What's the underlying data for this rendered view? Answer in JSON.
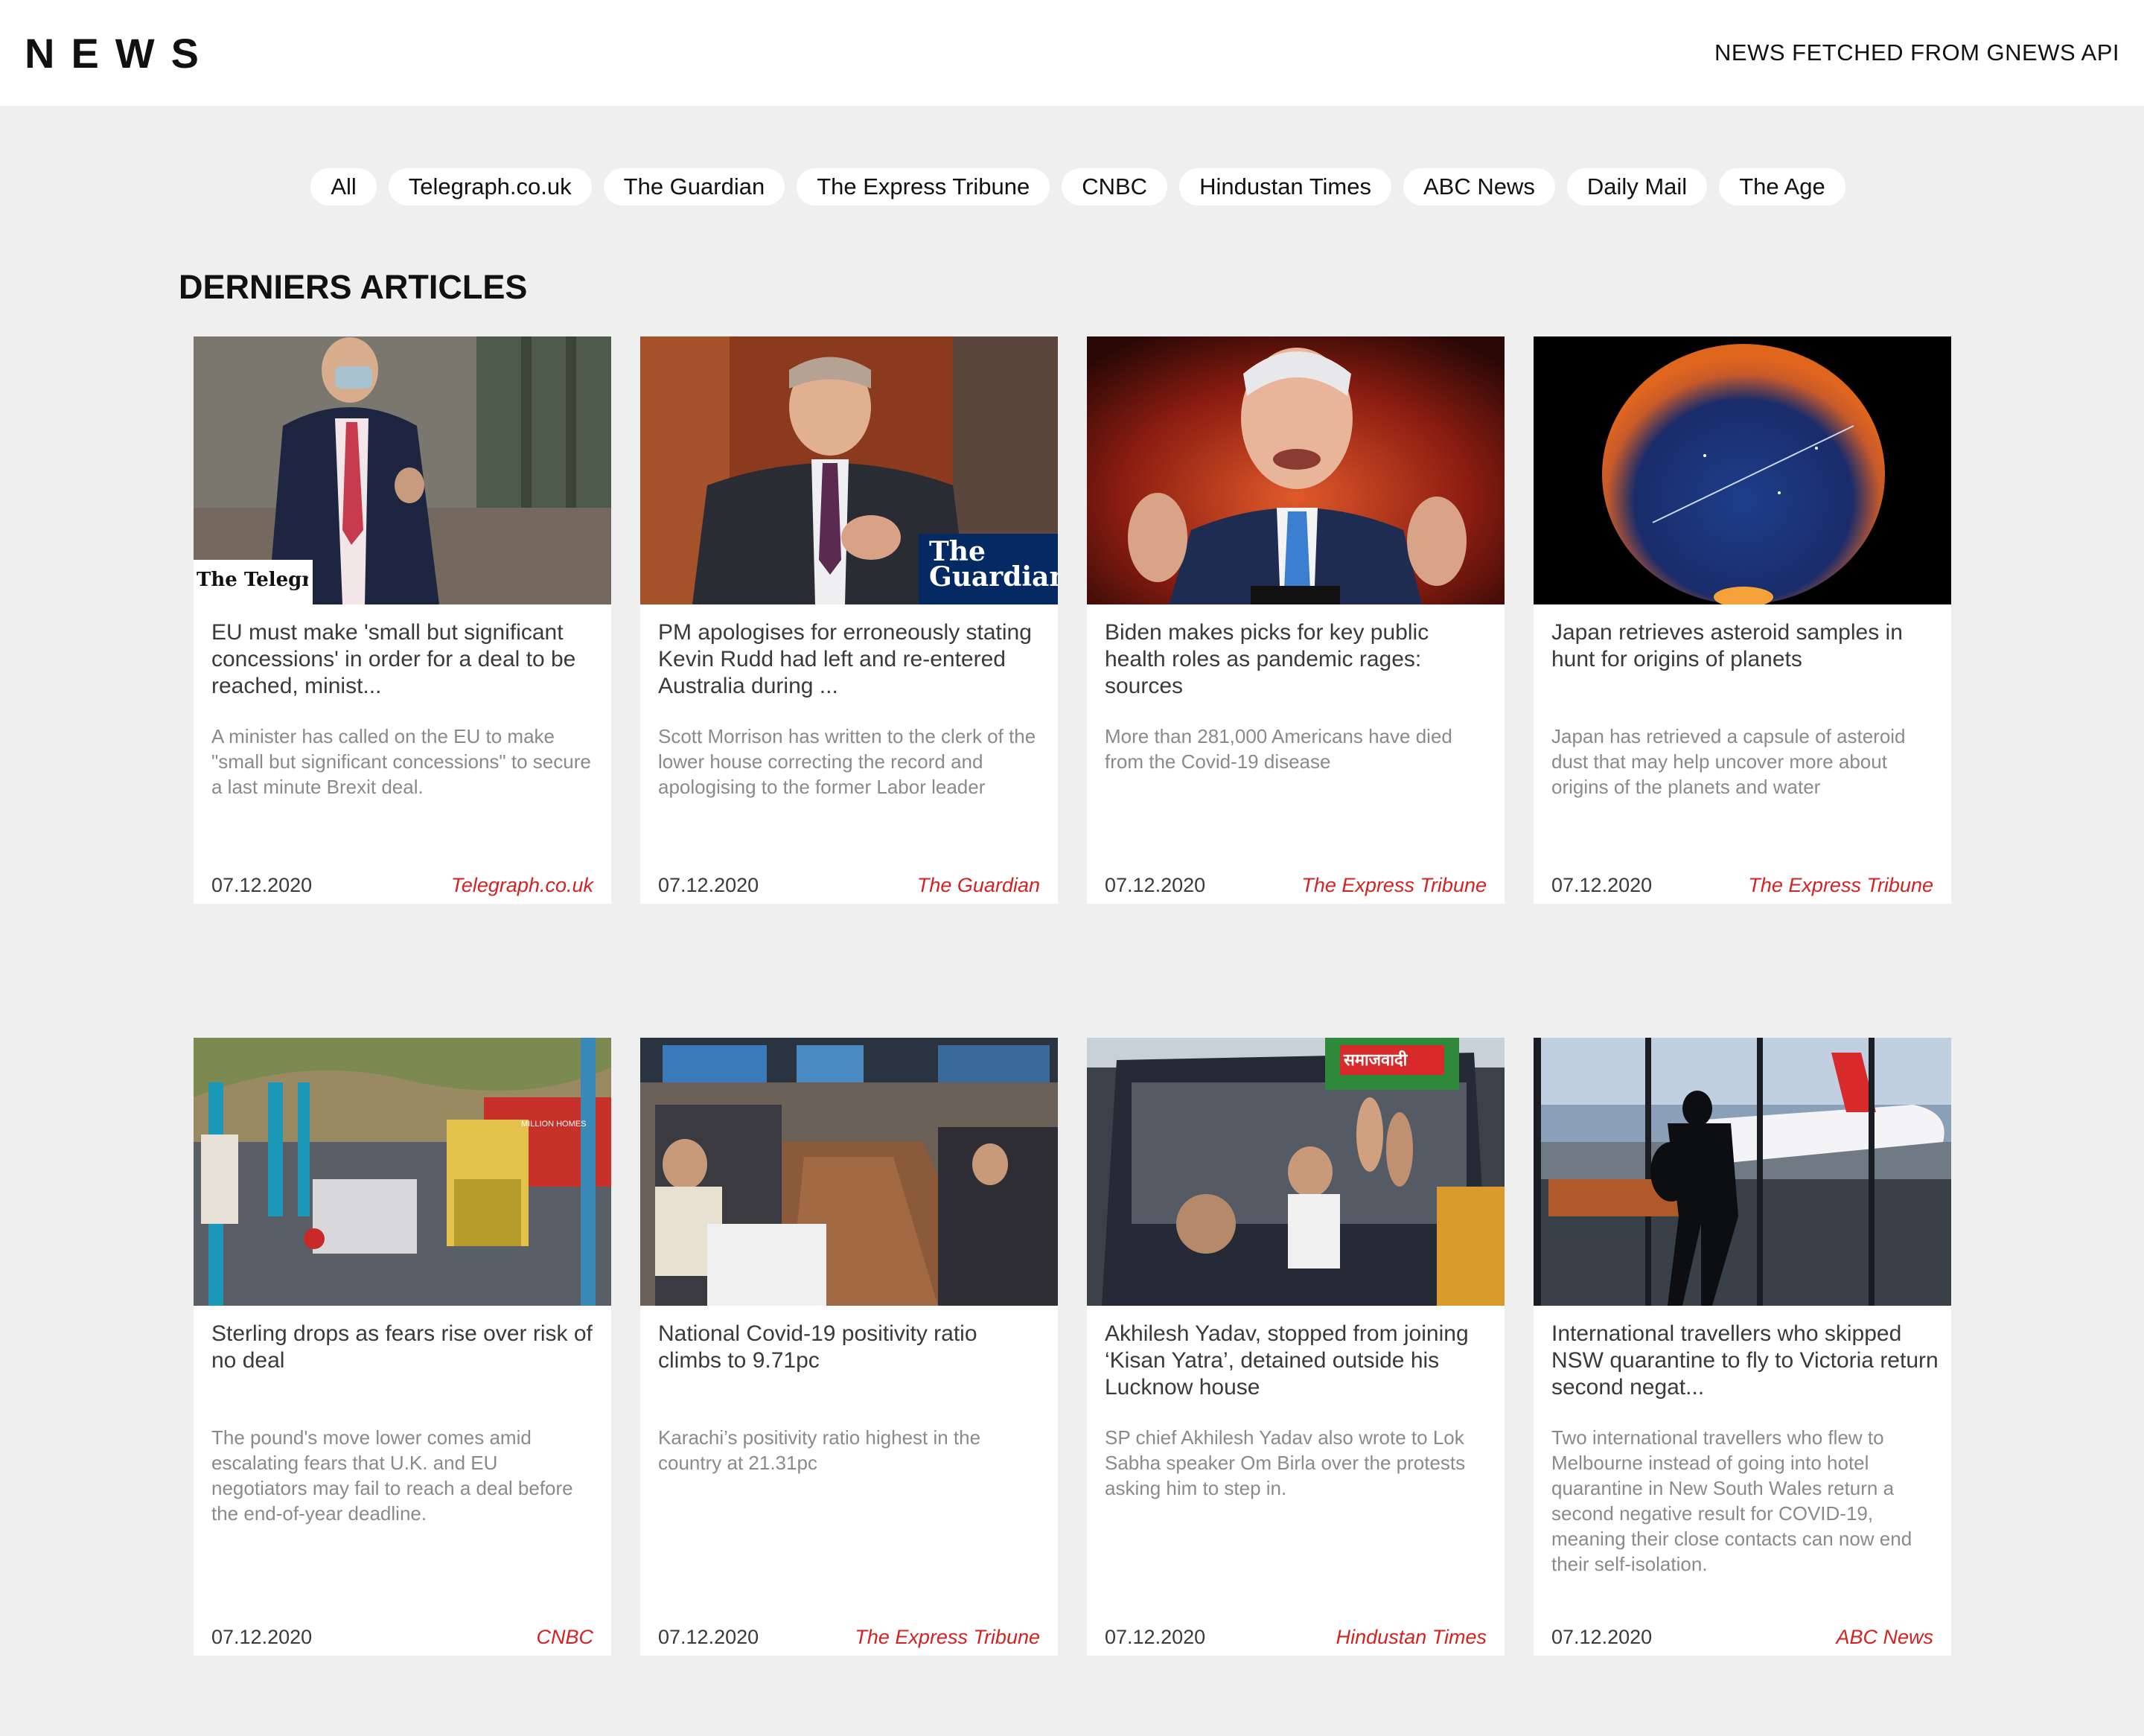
{
  "header": {
    "logo": "NEWS",
    "tagline": "NEWS FETCHED FROM GNEWS API"
  },
  "filters": [
    "All",
    "Telegraph.co.uk",
    "The Guardian",
    "The Express Tribune",
    "CNBC",
    "Hindustan Times",
    "ABC News",
    "Daily Mail",
    "The Age"
  ],
  "section_title": "DERNIERS ARTICLES",
  "articles": [
    {
      "title": "EU must make 'small but significant concessions' in order for a deal to be reached, minist...",
      "description": "A minister has called on the EU to make \"small but significant concessions\" to secure a last minute Brexit deal.",
      "date": "07.12.2020",
      "source": "Telegraph.co.uk",
      "image_watermark": "The Telegraph"
    },
    {
      "title": "PM apologises for erroneously stating Kevin Rudd had left and re-entered Australia during ...",
      "description": "Scott Morrison has written to the clerk of the lower house correcting the record and apologising to the former Labor leader",
      "date": "07.12.2020",
      "source": "The Guardian",
      "image_watermark": "The Guardian"
    },
    {
      "title": "Biden makes picks for key public health roles as pandemic rages: sources",
      "description": "More than 281,000 Americans have died from the Covid-19 disease",
      "date": "07.12.2020",
      "source": "The Express Tribune"
    },
    {
      "title": "Japan retrieves asteroid samples in hunt for origins of planets",
      "description": "Japan has retrieved a capsule of asteroid dust that may help uncover more about origins of the planets and water",
      "date": "07.12.2020",
      "source": "The Express Tribune"
    },
    {
      "title": "Sterling drops as fears rise over risk of no deal",
      "description": "The pound's move lower comes amid escalating fears that U.K. and EU negotiators may fail to reach a deal before the end-of-year deadline.",
      "date": "07.12.2020",
      "source": "CNBC",
      "image_text": "MILLION HOMES"
    },
    {
      "title": "National Covid-19 positivity ratio climbs to 9.71pc",
      "description": "Karachi’s positivity ratio highest in the country at 21.31pc",
      "date": "07.12.2020",
      "source": "The Express Tribune"
    },
    {
      "title": "Akhilesh Yadav, stopped from joining ‘Kisan Yatra’, detained outside his Lucknow house",
      "description": "SP chief Akhilesh Yadav also wrote to Lok Sabha speaker Om Birla over the protests asking him to step in.",
      "date": "07.12.2020",
      "source": "Hindustan Times",
      "image_text": "समाजवादी"
    },
    {
      "title": "International travellers who skipped NSW quarantine to fly to Victoria return second negat...",
      "description": "Two international travellers who flew to Melbourne instead of going into hotel quarantine in New South Wales return a second negative result for COVID-19, meaning their close contacts can now end their self-isolation.",
      "date": "07.12.2020",
      "source": "ABC News"
    }
  ]
}
